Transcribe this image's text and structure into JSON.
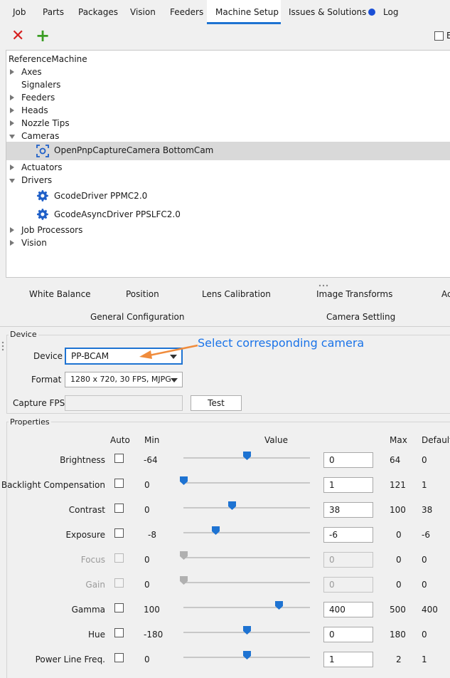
{
  "tabs": [
    {
      "label": "Job"
    },
    {
      "label": "Parts"
    },
    {
      "label": "Packages"
    },
    {
      "label": "Vision"
    },
    {
      "label": "Feeders"
    },
    {
      "label": "Machine Setup",
      "active": true
    },
    {
      "label": "Issues & Solutions"
    },
    {
      "label": "Log"
    }
  ],
  "toolbar": {
    "checkbox_label": "E"
  },
  "tree": {
    "root": "ReferenceMachine",
    "items": {
      "axes": "Axes",
      "signalers": "Signalers",
      "feeders": "Feeders",
      "heads": "Heads",
      "nozzle_tips": "Nozzle Tips",
      "cameras": "Cameras",
      "camera_child": "OpenPnpCaptureCamera BottomCam",
      "actuators": "Actuators",
      "drivers": "Drivers",
      "driver1": "GcodeDriver PPMC2.0",
      "driver2": "GcodeAsyncDriver PPSLFC2.0",
      "job_processors": "Job Processors",
      "vision": "Vision"
    }
  },
  "subtabs": {
    "white_balance": "White Balance",
    "position": "Position",
    "lens_calibration": "Lens Calibration",
    "image_transforms": "Image Transforms",
    "partial": "Ac",
    "general_configuration": "General Configuration",
    "camera_settling": "Camera Settling"
  },
  "device": {
    "group_title": "Device",
    "device_label": "Device",
    "device_value": "PP-BCAM",
    "annotation": "Select corresponding camera",
    "format_label": "Format",
    "format_value": "1280 x 720, 30 FPS, MJPG",
    "fps_label": "Capture FPS",
    "fps_value": "",
    "test_button": "Test"
  },
  "properties": {
    "group_title": "Properties",
    "headers": {
      "auto": "Auto",
      "min": "Min",
      "value": "Value",
      "max": "Max",
      "default": "Default"
    },
    "rows": [
      {
        "name": "Brightness",
        "min": "-64",
        "value": "0",
        "max": "64",
        "default": "0",
        "fraction": 0.5,
        "enabled": true
      },
      {
        "name": "Backlight Compensation",
        "min": "0",
        "value": "1",
        "max": "121",
        "default": "1",
        "fraction": 0.0,
        "enabled": true
      },
      {
        "name": "Contrast",
        "min": "0",
        "value": "38",
        "max": "100",
        "default": "38",
        "fraction": 0.38,
        "enabled": true
      },
      {
        "name": "Exposure",
        "min": "-8",
        "value": "-6",
        "max": "0",
        "default": "-6",
        "fraction": 0.25,
        "enabled": true
      },
      {
        "name": "Focus",
        "min": "0",
        "value": "0",
        "max": "0",
        "default": "0",
        "fraction": 0.0,
        "enabled": false
      },
      {
        "name": "Gain",
        "min": "0",
        "value": "0",
        "max": "0",
        "default": "0",
        "fraction": 0.0,
        "enabled": false
      },
      {
        "name": "Gamma",
        "min": "100",
        "value": "400",
        "max": "500",
        "default": "400",
        "fraction": 0.75,
        "enabled": true
      },
      {
        "name": "Hue",
        "min": "-180",
        "value": "0",
        "max": "180",
        "default": "0",
        "fraction": 0.5,
        "enabled": true
      },
      {
        "name": "Power Line Freq.",
        "min": "0",
        "value": "1",
        "max": "2",
        "default": "1",
        "fraction": 0.5,
        "enabled": true
      }
    ]
  },
  "colors": {
    "accent": "#1e73d2",
    "annotation": "#1a73e8",
    "arrow": "#f08c3c",
    "delete": "#d62020",
    "add": "#3a9d23"
  }
}
